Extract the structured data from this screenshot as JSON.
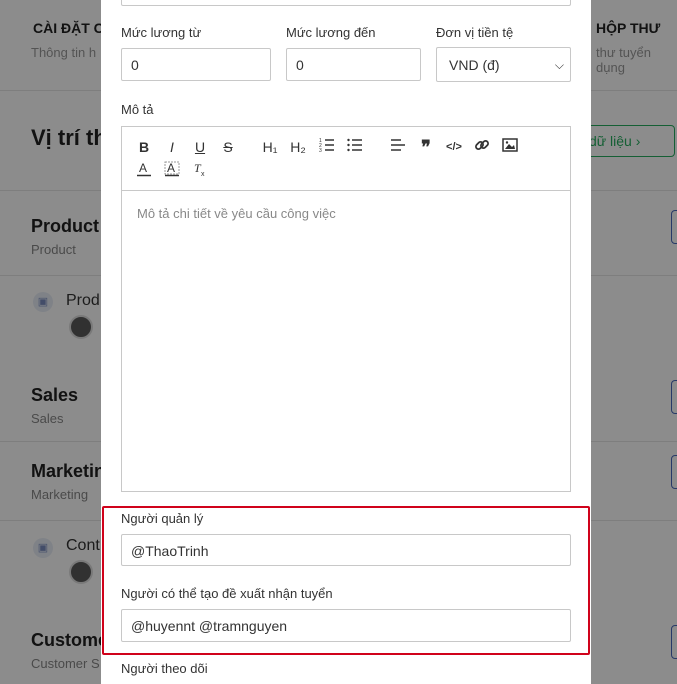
{
  "background": {
    "tab_left": "CÀI ĐẶT C",
    "tab_left_sub": "Thông tin h",
    "tab_right": "HỘP THƯ",
    "tab_right_sub": "thư tuyển dụng",
    "heading": "Vị trí th",
    "import_button": "dữ liệu",
    "groups": [
      {
        "title": "Product",
        "sub": "Product"
      },
      {
        "title": "Sales",
        "sub": "Sales"
      },
      {
        "title": "Marketin",
        "sub": "Marketing"
      },
      {
        "title": "Custome",
        "sub": "Customer S"
      }
    ],
    "rows": [
      "Prod",
      "Cont"
    ]
  },
  "form": {
    "salary_from_label": "Mức lương từ",
    "salary_from_value": "0",
    "salary_to_label": "Mức lương đến",
    "salary_to_value": "0",
    "currency_label": "Đơn vị tiền tệ",
    "currency_value": "VND (đ)",
    "description_label": "Mô tả",
    "description_placeholder": "Mô tả chi tiết về yêu cầu công việc",
    "manager_label": "Người quản lý",
    "manager_value": "@ThaoTrinh",
    "proposer_label": "Người có thể tạo đề xuất nhận tuyển",
    "proposer_value": "@huyennt @tramnguyen",
    "follower_label": "Người theo dõi"
  },
  "toolbar": {
    "bold": "B",
    "italic": "I",
    "underline": "U",
    "strike": "S",
    "h1": "H₁",
    "h2": "H₂",
    "quote": "❞",
    "code": "</>"
  },
  "colors": {
    "highlight": "#d0021b",
    "accent_green": "#27ae60"
  }
}
